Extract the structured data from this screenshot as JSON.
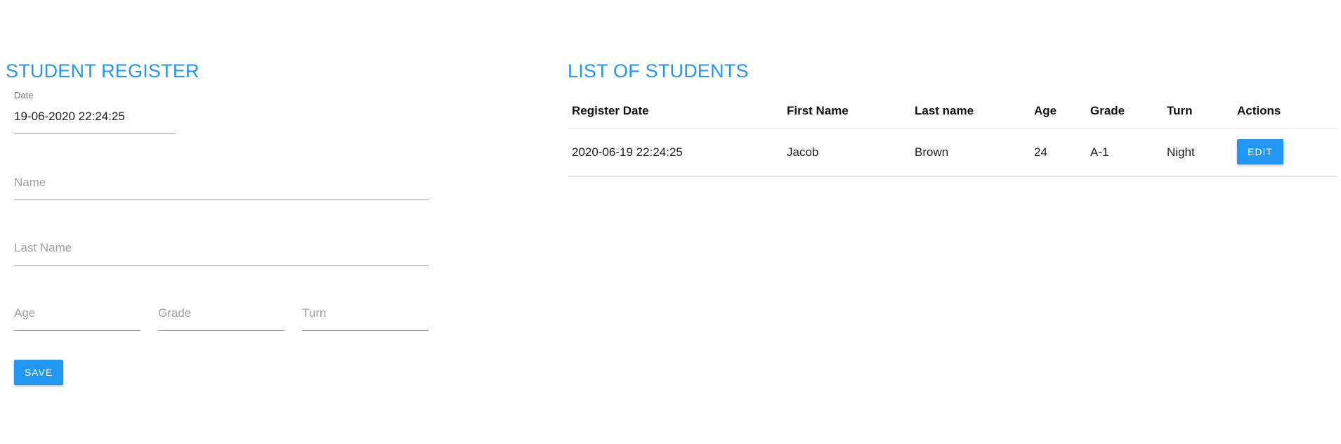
{
  "colors": {
    "accent": "#2196f3",
    "field_line": "#9e9e9e",
    "placeholder": "#9e9e9e"
  },
  "register": {
    "title": "STUDENT REGISTER",
    "date_label": "Date",
    "date_value": "19-06-2020 22:24:25",
    "name_placeholder": "Name",
    "last_name_placeholder": "Last Name",
    "age_placeholder": "Age",
    "grade_placeholder": "Grade",
    "turn_placeholder": "Turn",
    "save_label": "SAVE"
  },
  "list": {
    "title": "LIST OF STUDENTS",
    "headers": [
      "Register Date",
      "First Name",
      "Last name",
      "Age",
      "Grade",
      "Turn",
      "Actions"
    ],
    "rows": [
      {
        "register_date": "2020-06-19 22:24:25",
        "first_name": "Jacob",
        "last_name": "Brown",
        "age": "24",
        "grade": "A-1",
        "turn": "Night",
        "action_label": "EDIT"
      }
    ]
  }
}
